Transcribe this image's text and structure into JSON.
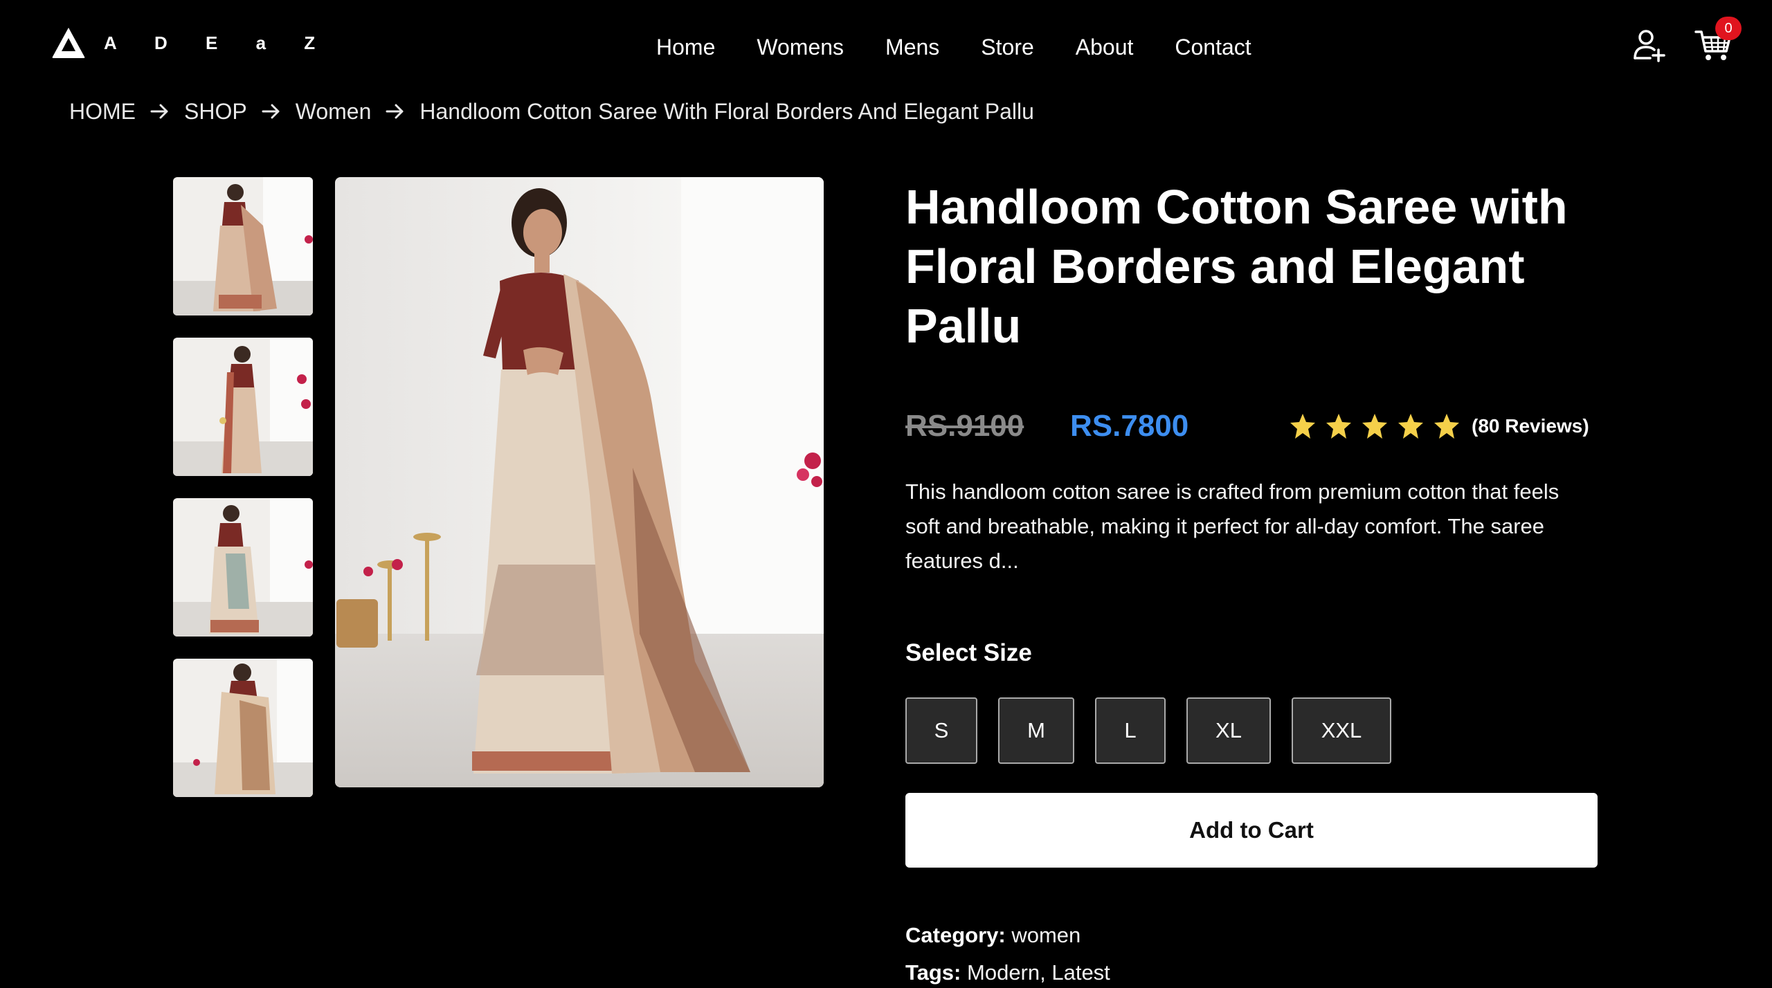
{
  "header": {
    "logo_text": "A D E a Z",
    "nav": [
      "Home",
      "Womens",
      "Mens",
      "Store",
      "About",
      "Contact"
    ],
    "cart_count": "0"
  },
  "breadcrumb": [
    "HOME",
    "SHOP",
    "Women",
    "Handloom Cotton Saree With Floral Borders And Elegant Pallu"
  ],
  "product": {
    "title": "Handloom Cotton Saree with Floral Borders and Elegant Pallu",
    "old_price": "RS.9100",
    "new_price": "RS.7800",
    "rating": 5,
    "reviews": "(80 Reviews)",
    "description": "This handloom cotton saree is crafted from premium cotton that feels soft and breathable, making it perfect for all-day comfort. The saree features d...",
    "size_label": "Select Size",
    "sizes": [
      "S",
      "M",
      "L",
      "XL",
      "XXL"
    ],
    "add_to_cart": "Add to Cart",
    "category_label": "Category:",
    "category": "women",
    "tags_label": "Tags:",
    "tags": "Modern, Latest"
  },
  "gallery": {
    "thumbnail_count": 4
  },
  "colors": {
    "background": "#000000",
    "accent_price": "#3d8ef0",
    "star": "#f5d04a",
    "badge": "#e0141e"
  },
  "icons": {
    "logo": "triangle-logo-icon",
    "account": "user-plus-icon",
    "cart": "shopping-cart-icon",
    "breadcrumb_separator": "arrow-right-icon",
    "rating": "star-icon"
  }
}
